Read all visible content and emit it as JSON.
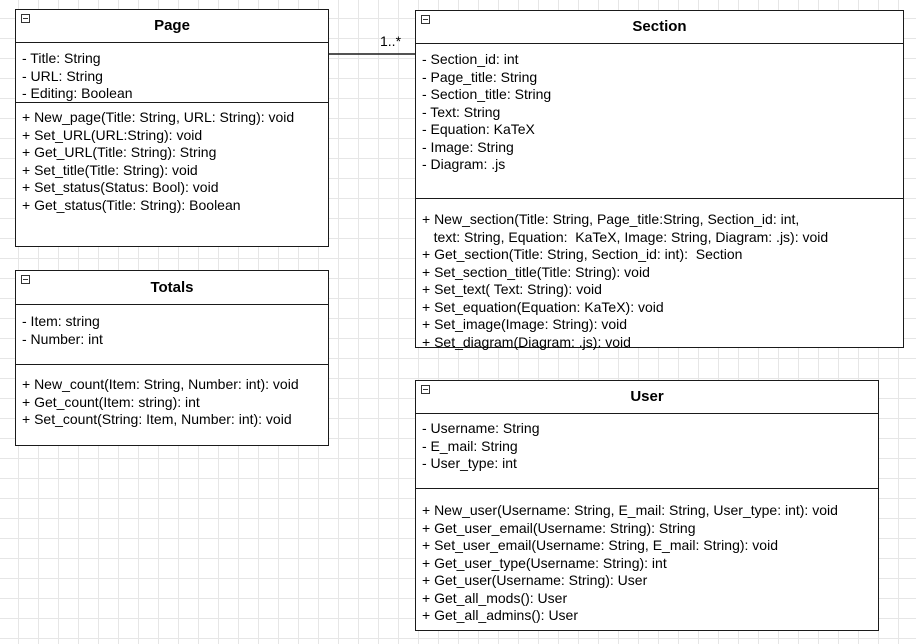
{
  "association": {
    "multiplicity": "1..*"
  },
  "classes": {
    "page": {
      "name": "Page",
      "attributes": [
        "- Title: String",
        "- URL: String",
        "- Editing: Boolean"
      ],
      "methods": [
        "+ New_page(Title: String, URL: String): void",
        "+ Set_URL(URL:String): void",
        "+ Get_URL(Title: String): String",
        "+ Set_title(Title: String): void",
        "+ Set_status(Status: Bool): void",
        "+ Get_status(Title: String): Boolean"
      ]
    },
    "totals": {
      "name": "Totals",
      "attributes": [
        "- Item: string",
        "- Number: int"
      ],
      "methods": [
        "+ New_count(Item: String, Number: int): void",
        "+ Get_count(Item: string): int",
        "+ Set_count(String: Item, Number: int): void"
      ]
    },
    "section": {
      "name": "Section",
      "attributes": [
        "- Section_id: int",
        "- Page_title: String",
        "- Section_title: String",
        "- Text: String",
        "- Equation: KaTeX",
        "- Image: String",
        "- Diagram: .js"
      ],
      "methods": [
        "+ New_section(Title: String, Page_title:String, Section_id: int,",
        "   text: String, Equation:  KaTeX, Image: String, Diagram: .js): void",
        "+ Get_section(Title: String, Section_id: int):  Section",
        "+ Set_section_title(Title: String): void",
        "+ Set_text( Text: String): void",
        "+ Set_equation(Equation: KaTeX): void",
        "+ Set_image(Image: String): void",
        "+ Set_diagram(Diagram: .js): void"
      ]
    },
    "user": {
      "name": "User",
      "attributes": [
        "- Username: String",
        "- E_mail: String",
        "- User_type: int"
      ],
      "methods": [
        "+ New_user(Username: String, E_mail: String, User_type: int): void",
        "+ Get_user_email(Username: String): String",
        "+ Set_user_email(Username: String, E_mail: String): void",
        "+ Get_user_type(Username: String): int",
        "+ Get_user(Username: String): User",
        "+ Get_all_mods(): User",
        "+ Get_all_admins(): User"
      ]
    }
  }
}
